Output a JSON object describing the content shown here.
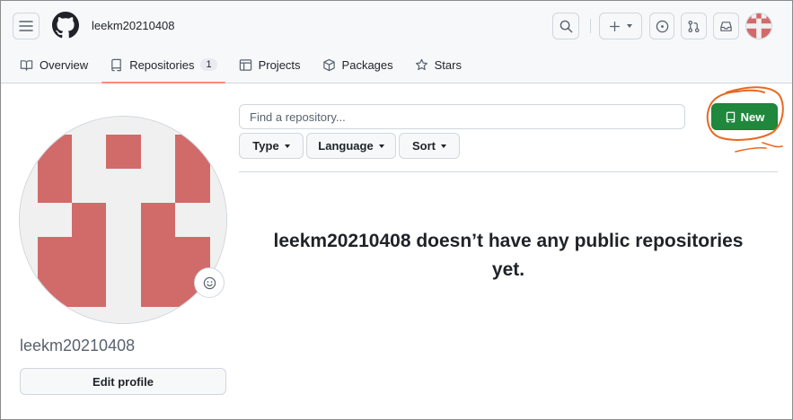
{
  "header": {
    "username": "leekm20210408",
    "icons": [
      "hamburger-icon",
      "github-logo-icon",
      "search-icon",
      "plus-icon",
      "issues-icon",
      "pull-request-icon",
      "inbox-icon"
    ]
  },
  "tabs": [
    {
      "label": "Overview",
      "icon": "book-icon"
    },
    {
      "label": "Repositories",
      "icon": "repo-icon",
      "count": "1",
      "selected": true
    },
    {
      "label": "Projects",
      "icon": "table-icon"
    },
    {
      "label": "Packages",
      "icon": "package-icon"
    },
    {
      "label": "Stars",
      "icon": "star-icon"
    }
  ],
  "profile": {
    "name": "leekm20210408",
    "edit_label": "Edit profile",
    "avatar_color": "#d06b6a"
  },
  "repos": {
    "search_placeholder": "Find a repository...",
    "filters": {
      "type": "Type",
      "language": "Language",
      "sort": "Sort"
    },
    "new_label": "New",
    "empty_message": "leekm20210408 doesn’t have any public repositories yet."
  },
  "colors": {
    "accent_green": "#1f883d",
    "tab_underline": "#fd8c73",
    "annotation": "#e8691f"
  }
}
